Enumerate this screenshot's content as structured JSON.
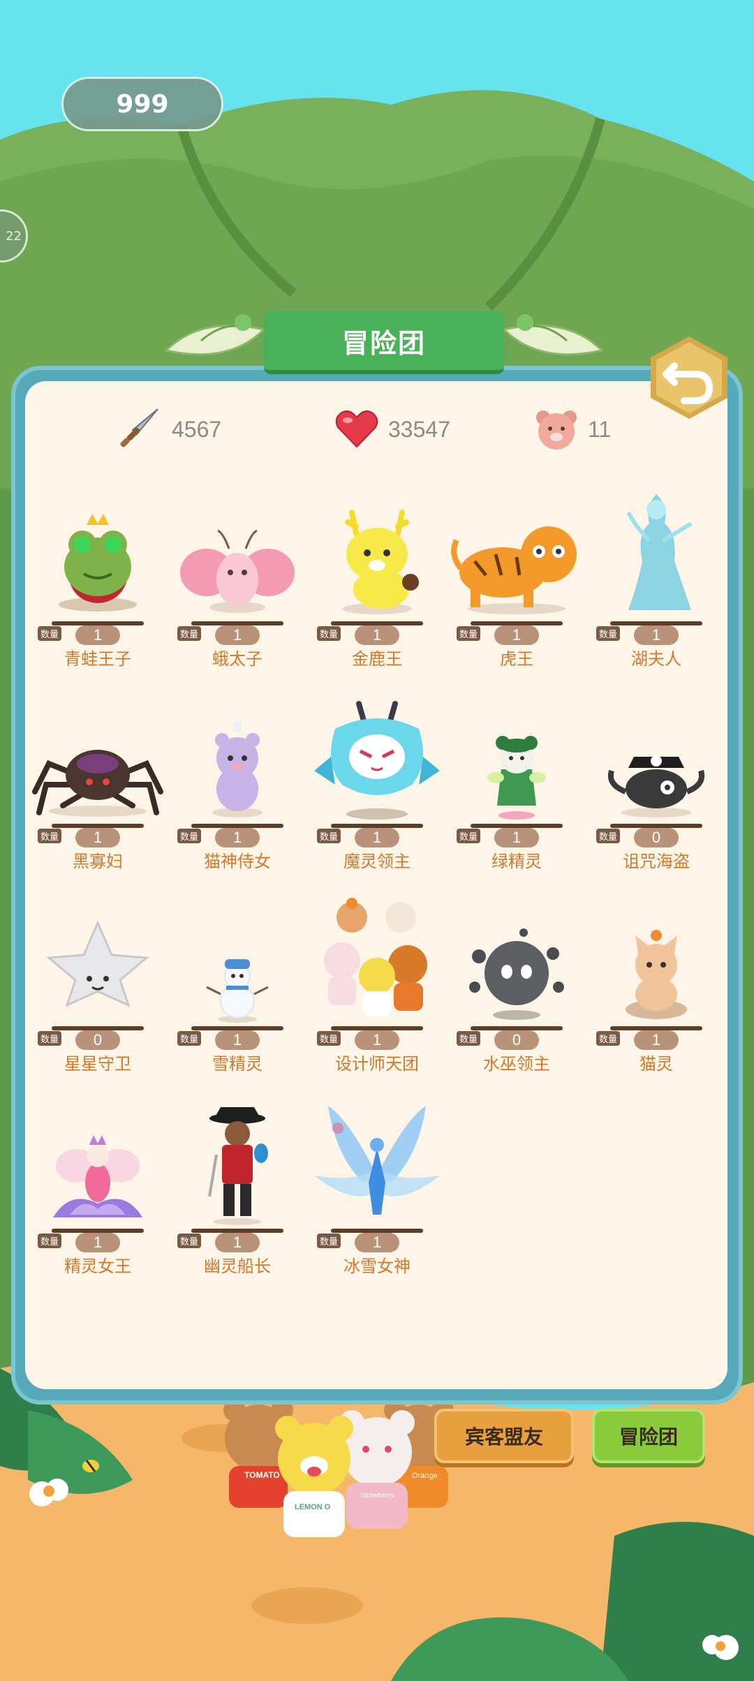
{
  "header": {
    "currency_value": "999",
    "side_badge_text": "22"
  },
  "panel": {
    "title": "冒险团",
    "stats": {
      "attack": "4567",
      "health": "33547",
      "members": "11"
    },
    "quantity_label": "数量",
    "characters": [
      {
        "name": "青蛙王子",
        "count": "1"
      },
      {
        "name": "蛾太子",
        "count": "1"
      },
      {
        "name": "金鹿王",
        "count": "1"
      },
      {
        "name": "虎王",
        "count": "1"
      },
      {
        "name": "湖夫人",
        "count": "1"
      },
      {
        "name": "黑寡妇",
        "count": "1"
      },
      {
        "name": "猫神侍女",
        "count": "1"
      },
      {
        "name": "魔灵领主",
        "count": "1"
      },
      {
        "name": "绿精灵",
        "count": "1"
      },
      {
        "name": "诅咒海盗",
        "count": "0"
      },
      {
        "name": "星星守卫",
        "count": "0"
      },
      {
        "name": "雪精灵",
        "count": "1"
      },
      {
        "name": "设计师天团",
        "count": "1"
      },
      {
        "name": "水巫领主",
        "count": "0"
      },
      {
        "name": "猫灵",
        "count": "1"
      },
      {
        "name": "精灵女王",
        "count": "1"
      },
      {
        "name": "幽灵船长",
        "count": "1"
      },
      {
        "name": "冰雪女神",
        "count": "1"
      }
    ]
  },
  "bottom_buttons": {
    "guest_friends": "宾客盟友",
    "adventure_team": "冒险团"
  },
  "bears": {
    "tomato": "TOMATO",
    "lemon": "LEMON O",
    "strawberry": "Strawberry",
    "orange": "Orange"
  }
}
